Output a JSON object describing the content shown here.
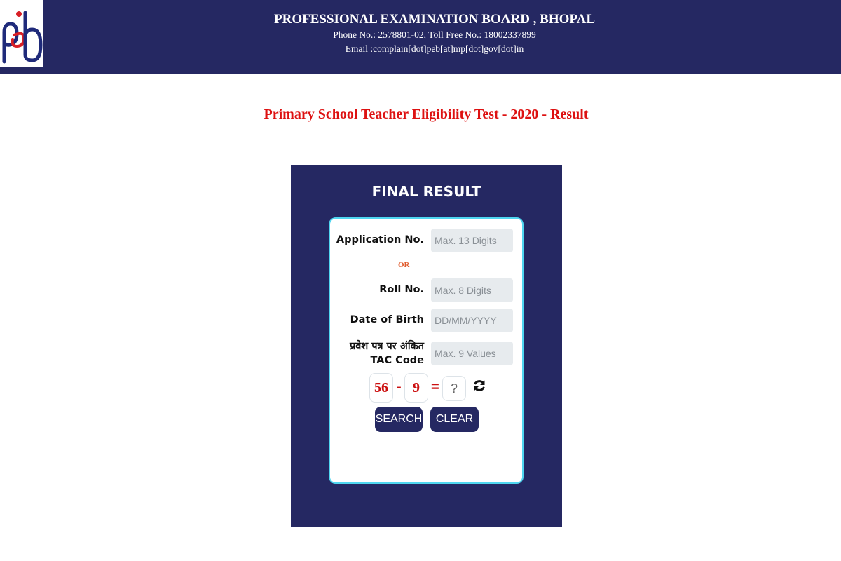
{
  "header": {
    "org_name": "PROFESSIONAL EXAMINATION BOARD , BHOPAL",
    "phone_line": "Phone No.: 2578801-02, Toll Free No.: 18002337899",
    "email_line": "Email :complain[dot]peb[at]mp[dot]gov[dot]in"
  },
  "page_title": "Primary School Teacher Eligibility Test - 2020 - Result",
  "panel": {
    "heading": "FINAL RESULT"
  },
  "form": {
    "application_label": "Application No.",
    "application_placeholder": "Max. 13 Digits",
    "or_text": "OR",
    "roll_label": "Roll No.",
    "roll_placeholder": "Max. 8 Digits",
    "dob_label": "Date of Birth",
    "dob_placeholder": "DD/MM/YYYY",
    "tac_label_hindi": "प्रवेश पत्र पर अंकित",
    "tac_label": "TAC Code",
    "tac_placeholder": "Max. 9 Values",
    "captcha": {
      "operand1": "56",
      "operator": "-",
      "operand2": "9",
      "equals": "=",
      "answer_placeholder": "?"
    },
    "search_label": "SEARCH",
    "clear_label": "CLEAR"
  },
  "colors": {
    "header_bg": "#252862",
    "title_red": "#d11111",
    "card_border": "#4fd6f0",
    "input_bg": "#e7ebee"
  },
  "icons": {
    "logo": "peb-logo",
    "refresh": "refresh-icon"
  }
}
